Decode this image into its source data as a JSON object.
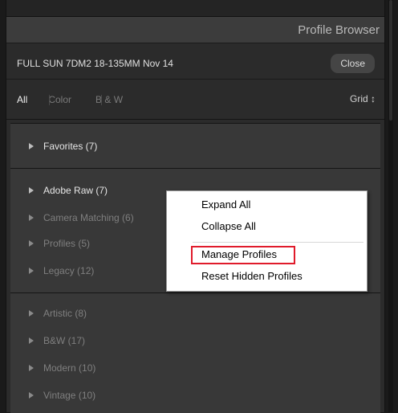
{
  "panel": {
    "title": "Profile Browser",
    "camera": "FULL SUN 7DM2 18-135MM Nov 14",
    "close_label": "Close"
  },
  "filters": {
    "all": "All",
    "color": "Color",
    "bw": "B & W",
    "view": "Grid ↕"
  },
  "groups": {
    "favorites": "Favorites (7)",
    "adobe_raw": "Adobe Raw (7)",
    "camera_matching": "Camera Matching (6)",
    "profiles": "Profiles (5)",
    "legacy": "Legacy (12)",
    "artistic": "Artistic (8)",
    "bw": "B&W (17)",
    "modern": "Modern (10)",
    "vintage": "Vintage (10)"
  },
  "context_menu": {
    "expand_all": "Expand All",
    "collapse_all": "Collapse All",
    "manage_profiles": "Manage Profiles",
    "reset_hidden": "Reset Hidden Profiles"
  }
}
